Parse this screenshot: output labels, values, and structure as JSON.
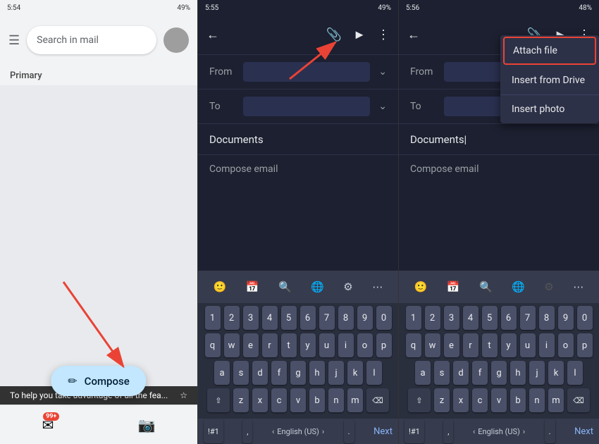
{
  "panels": {
    "panel1": {
      "status": {
        "time": "5:54",
        "battery": "49%"
      },
      "search_placeholder": "Search in mail",
      "primary_label": "Primary",
      "compose_label": "Compose",
      "badge_count": "99+",
      "notification_text": "To help you take advantage of all the fea...",
      "star": "☆"
    },
    "panel2": {
      "status": {
        "time": "5:55",
        "battery": "49%"
      },
      "from_label": "From",
      "to_label": "To",
      "subject_label": "Documents",
      "compose_placeholder": "Compose email",
      "keyboard": {
        "row1": [
          "1",
          "2",
          "3",
          "4",
          "5",
          "6",
          "7",
          "8",
          "9",
          "0"
        ],
        "row2": [
          "q",
          "w",
          "e",
          "r",
          "t",
          "y",
          "u",
          "i",
          "o",
          "p"
        ],
        "row3": [
          "a",
          "s",
          "d",
          "f",
          "g",
          "h",
          "j",
          "k",
          "l"
        ],
        "row4": [
          "z",
          "x",
          "c",
          "v",
          "b",
          "n",
          "m"
        ],
        "special_left": "!#1",
        "special_comma": ",",
        "language": "English (US)",
        "next_label": "Next"
      }
    },
    "panel3": {
      "status": {
        "time": "5:56",
        "battery": "48%"
      },
      "from_label": "From",
      "to_label": "To",
      "subject_label": "Documents",
      "compose_placeholder": "Compose email",
      "dropdown": {
        "attach_file": "Attach file",
        "insert_from_drive": "Insert from Drive",
        "insert_photo": "Insert photo"
      },
      "keyboard": {
        "row1": [
          "1",
          "2",
          "3",
          "4",
          "5",
          "6",
          "7",
          "8",
          "9",
          "0"
        ],
        "row2": [
          "q",
          "w",
          "e",
          "r",
          "t",
          "y",
          "u",
          "i",
          "o",
          "p"
        ],
        "row3": [
          "a",
          "s",
          "d",
          "f",
          "g",
          "h",
          "j",
          "k",
          "l"
        ],
        "row4": [
          "z",
          "x",
          "c",
          "v",
          "b",
          "n",
          "m"
        ],
        "special_left": "!#1",
        "special_comma": ",",
        "language": "English (US)",
        "next_label": "Next"
      }
    }
  }
}
